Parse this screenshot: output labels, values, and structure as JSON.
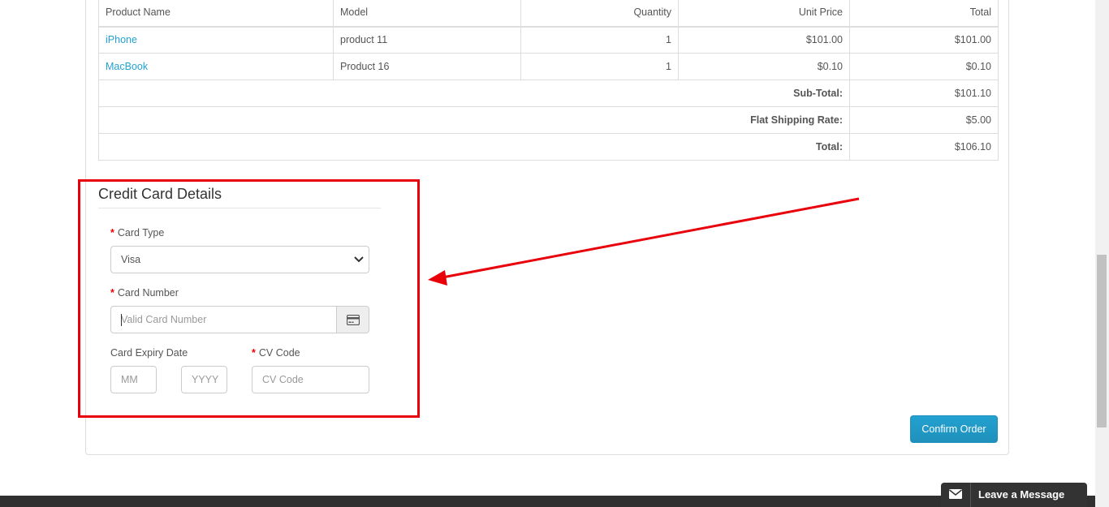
{
  "cart": {
    "headers": [
      "Product Name",
      "Model",
      "Quantity",
      "Unit Price",
      "Total"
    ],
    "rows": [
      {
        "name": "iPhone",
        "model": "product 11",
        "qty": "1",
        "price": "$101.00",
        "total": "$101.00"
      },
      {
        "name": "MacBook",
        "model": "Product 16",
        "qty": "1",
        "price": "$0.10",
        "total": "$0.10"
      }
    ],
    "totals": [
      {
        "label": "Sub-Total:",
        "value": "$101.10"
      },
      {
        "label": "Flat Shipping Rate:",
        "value": "$5.00"
      },
      {
        "label": "Total:",
        "value": "$106.10"
      }
    ]
  },
  "credit_card": {
    "legend": "Credit Card Details",
    "card_type_label": "Card Type",
    "card_type_value": "Visa",
    "card_number_label": "Card Number",
    "card_number_placeholder": "Valid Card Number",
    "expiry_label": "Card Expiry Date",
    "month_placeholder": "MM",
    "year_placeholder": "YYYY",
    "cv_label": "CV Code",
    "cv_placeholder": "CV Code",
    "required_mark": "*"
  },
  "confirm_button": "Confirm Order",
  "chat_widget": "Leave a Message",
  "colors": {
    "link": "#23a1d1",
    "button": "#229ac8",
    "highlight": "#e8000b",
    "required": "#f00000"
  },
  "icons": [
    "credit-card-icon",
    "chevron-down-icon",
    "envelope-icon"
  ]
}
